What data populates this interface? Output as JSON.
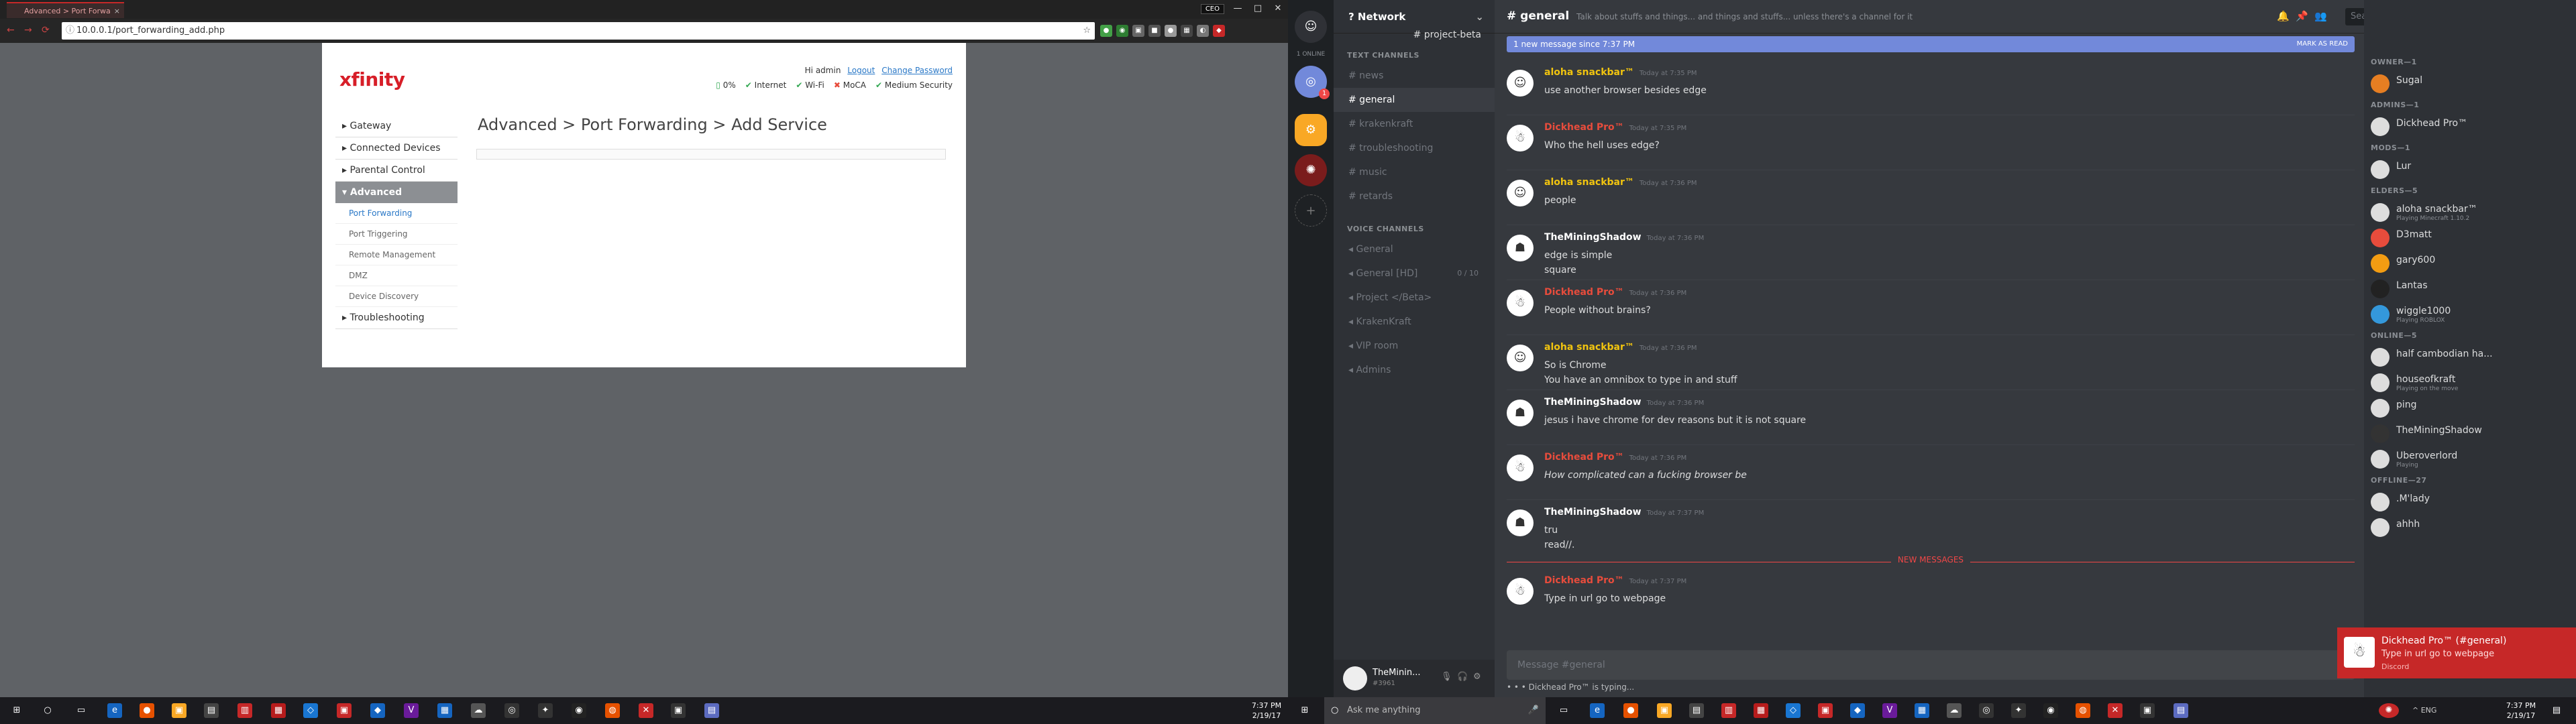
{
  "browser": {
    "tab_title": "Advanced > Port Forwa",
    "tab_close": "×",
    "url": "10.0.0.1/port_forwarding_add.php",
    "lock": "ⓘ",
    "star": "☆",
    "ceo_label": "CEO",
    "win_min": "—",
    "win_max": "□",
    "win_close": "✕",
    "nav_back": "←",
    "nav_fwd": "→",
    "nav_reload": "⟳",
    "extensions": [
      "●",
      "◉",
      "▣",
      "■",
      "●",
      "▦",
      "◐",
      "◆"
    ]
  },
  "xfinity": {
    "logo": "xfinity",
    "greeting": "Hi admin",
    "logout": "Logout",
    "change_password": "Change Password",
    "status": {
      "battery": "0%",
      "internet": "Internet",
      "wifi": "Wi-Fi",
      "moca": "MoCA",
      "security": "Medium Security"
    },
    "check": "✔",
    "cross": "✖",
    "nav": [
      {
        "label": "▸ Gateway"
      },
      {
        "label": "▸ Connected Devices"
      },
      {
        "label": "▸ Parental Control"
      }
    ],
    "advanced_label": "▾ Advanced",
    "sub": [
      {
        "label": "Port Forwarding"
      },
      {
        "label": "Port Triggering"
      },
      {
        "label": "Remote Management"
      },
      {
        "label": "DMZ"
      },
      {
        "label": "Device Discovery"
      }
    ],
    "troubleshooting": "▸ Troubleshooting",
    "page_title": "Advanced > Port Forwarding > Add Service"
  },
  "taskbar_left": {
    "icons": [
      "○",
      "▭",
      "e",
      "●",
      "▣",
      "▤",
      "▥",
      "▦",
      "◇",
      "▣",
      "◆",
      "V",
      "▦",
      "☁",
      "◎",
      "✦",
      "◉",
      "◍",
      "✕",
      "▣",
      "▤"
    ],
    "time": "7:37 PM",
    "date": "2/19/17"
  },
  "discord": {
    "online_label": "1 ONLINE",
    "guild_badge": "1",
    "guild_add": "+",
    "server_name": "? Network",
    "server_chev": "⌄",
    "text_cat": "TEXT CHANNELS",
    "text_channels": [
      {
        "label": "# news"
      },
      {
        "label": "# general"
      },
      {
        "label": "# project-beta"
      },
      {
        "label": "# krakenkraft"
      },
      {
        "label": "# troubleshooting"
      },
      {
        "label": "# music"
      },
      {
        "label": "# retards"
      }
    ],
    "voice_cat": "VOICE CHANNELS",
    "voice_channels": [
      {
        "label": "◂ General",
        "count": ""
      },
      {
        "label": "◂ General [HD]",
        "count": "0 / 10"
      },
      {
        "label": "◂ Project </Beta>",
        "count": ""
      },
      {
        "label": "◂ KrakenKraft",
        "count": ""
      },
      {
        "label": "◂ VIP room",
        "count": ""
      },
      {
        "label": "◂ Admins",
        "count": ""
      }
    ],
    "user_name": "TheMinin...",
    "user_tag": "#3961",
    "user_icons": [
      "🎙",
      "🎧",
      "⚙"
    ],
    "channel_name": "# general",
    "topic": "Talk about stuffs and things... and things and stuffs... unless there's a channel for it",
    "header_icons": [
      "🔔",
      "📌",
      "👥",
      "@",
      "?"
    ],
    "search_placeholder": "Search",
    "new_since": "1 new message since 7:37 PM",
    "mark_read": "MARK AS READ",
    "messages": [
      {
        "author": "aloha snackbar™",
        "time": "Today at 7:35 PM",
        "text": "use another browser besides edge",
        "avatar": "☺"
      },
      {
        "author": "Dickhead Pro™",
        "time": "Today at 7:35 PM",
        "text": "Who the hell uses edge?",
        "avatar": "☃"
      },
      {
        "author": "aloha snackbar™",
        "time": "Today at 7:36 PM",
        "text": "people",
        "avatar": "☺"
      },
      {
        "author": "TheMiningShadow",
        "time": "Today at 7:36 PM",
        "text": "edge is simple\nsquare",
        "avatar": "☗"
      },
      {
        "author": "Dickhead Pro™",
        "time": "Today at 7:36 PM",
        "text": "People without brains?",
        "avatar": "☃"
      },
      {
        "author": "aloha snackbar™",
        "time": "Today at 7:36 PM",
        "text": "So is Chrome\nYou have an omnibox to type in and stuff",
        "avatar": "☺"
      },
      {
        "author": "TheMiningShadow",
        "time": "Today at 7:36 PM",
        "text": "jesus i have chrome for dev reasons but it is not square",
        "avatar": "☗"
      },
      {
        "author": "Dickhead Pro™",
        "time": "Today at 7:36 PM",
        "text": "How complicated can a fucking browser be",
        "avatar": "☃"
      },
      {
        "author": "TheMiningShadow",
        "time": "Today at 7:37 PM",
        "text": "tru\nread//.",
        "avatar": "☗"
      }
    ],
    "new_messages_label": "NEW MESSAGES",
    "last_message": {
      "author": "Dickhead Pro™",
      "time": "Today at 7:37 PM",
      "text": "Type in url go to webpage",
      "avatar": "☃"
    },
    "input_placeholder": "Message #general",
    "typing": "• • •  Dickhead Pro™ is typing...",
    "member_groups": [
      {
        "cat": "OWNER—1",
        "members": [
          {
            "name": "Sugal",
            "sub": "",
            "color": "ora"
          }
        ]
      },
      {
        "cat": "ADMINS—1",
        "members": [
          {
            "name": "Dickhead Pro™",
            "sub": "",
            "color": "red"
          }
        ]
      },
      {
        "cat": "MODS—1",
        "members": [
          {
            "name": "Lur",
            "sub": "",
            "color": "yel"
          }
        ]
      },
      {
        "cat": "ELDERS—5",
        "members": [
          {
            "name": "aloha snackbar™",
            "sub": "Playing Minecraft 1.10.2",
            "color": "yel"
          },
          {
            "name": "D3matt",
            "sub": "",
            "color": "grn"
          },
          {
            "name": "gary600",
            "sub": "",
            "color": "grn"
          },
          {
            "name": "Lantas",
            "sub": "",
            "color": "grn"
          },
          {
            "name": "wiggle1000",
            "sub": "Playing ROBLOX",
            "color": "grn"
          }
        ]
      },
      {
        "cat": "ONLINE—5",
        "members": [
          {
            "name": "half cambodian ha...",
            "sub": "",
            "color": "wht"
          },
          {
            "name": "houseofkraft",
            "sub": "Playing on the move",
            "color": "wht"
          },
          {
            "name": "ping",
            "sub": "",
            "color": "wht"
          },
          {
            "name": "TheMiningShadow",
            "sub": "",
            "color": "wht"
          },
          {
            "name": "Uberoverlord",
            "sub": "Playing",
            "color": "wht"
          }
        ]
      },
      {
        "cat": "OFFLINE—27",
        "members": [
          {
            "name": ".M'lady",
            "sub": "",
            "color": "wht"
          },
          {
            "name": "ahhh",
            "sub": "",
            "color": "wht"
          }
        ]
      }
    ],
    "toast": {
      "title": "Dickhead Pro™ (#general)",
      "body": "Type in url go to webpage",
      "app": "Discord",
      "avatar": "☃"
    }
  },
  "taskbar_right": {
    "start": "⊞",
    "cortana_placeholder": "Ask me anything",
    "cortana_icon": "○",
    "mic_icon": "🎤",
    "icons": [
      "▭",
      "e",
      "●",
      "▣",
      "▤",
      "▥",
      "▦",
      "◇",
      "▣",
      "◆",
      "V",
      "▦",
      "☁",
      "◎",
      "✦",
      "◉",
      "◍",
      "✕",
      "▣",
      "▤"
    ],
    "tray": "^  ENG",
    "time": "7:37 PM",
    "date": "2/19/17",
    "notif": "▤"
  }
}
